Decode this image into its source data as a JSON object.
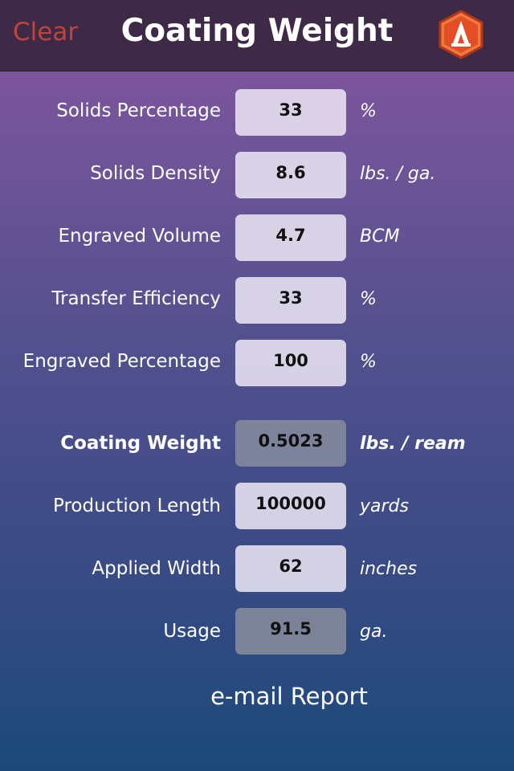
{
  "navbar": {
    "clear_label": "Clear",
    "title": "Coating Weight",
    "logo_icon": "app-logo-icon"
  },
  "rows": [
    {
      "label": "Solids Percentage",
      "value": "33",
      "unit": "%"
    },
    {
      "label": "Solids Density",
      "value": "8.6",
      "unit": "lbs. / ga."
    },
    {
      "label": "Engraved Volume",
      "value": "4.7",
      "unit": "BCM"
    },
    {
      "label": "Transfer Efficiency",
      "value": "33",
      "unit": "%"
    },
    {
      "label": "Engraved Percentage",
      "value": "100",
      "unit": "%"
    },
    {
      "label": "Coating Weight",
      "value": "0.5023",
      "unit": "lbs. / ream"
    },
    {
      "label": "Production Length",
      "value": "100000",
      "unit": "yards"
    },
    {
      "label": "Applied Width",
      "value": "62",
      "unit": "inches"
    },
    {
      "label": "Usage",
      "value": "91.5",
      "unit": "ga."
    }
  ],
  "email_label": "e-mail Report",
  "colors": {
    "clear": "#c0443c",
    "navbar": "#3e2947",
    "logo_orange": "#e8582a"
  }
}
